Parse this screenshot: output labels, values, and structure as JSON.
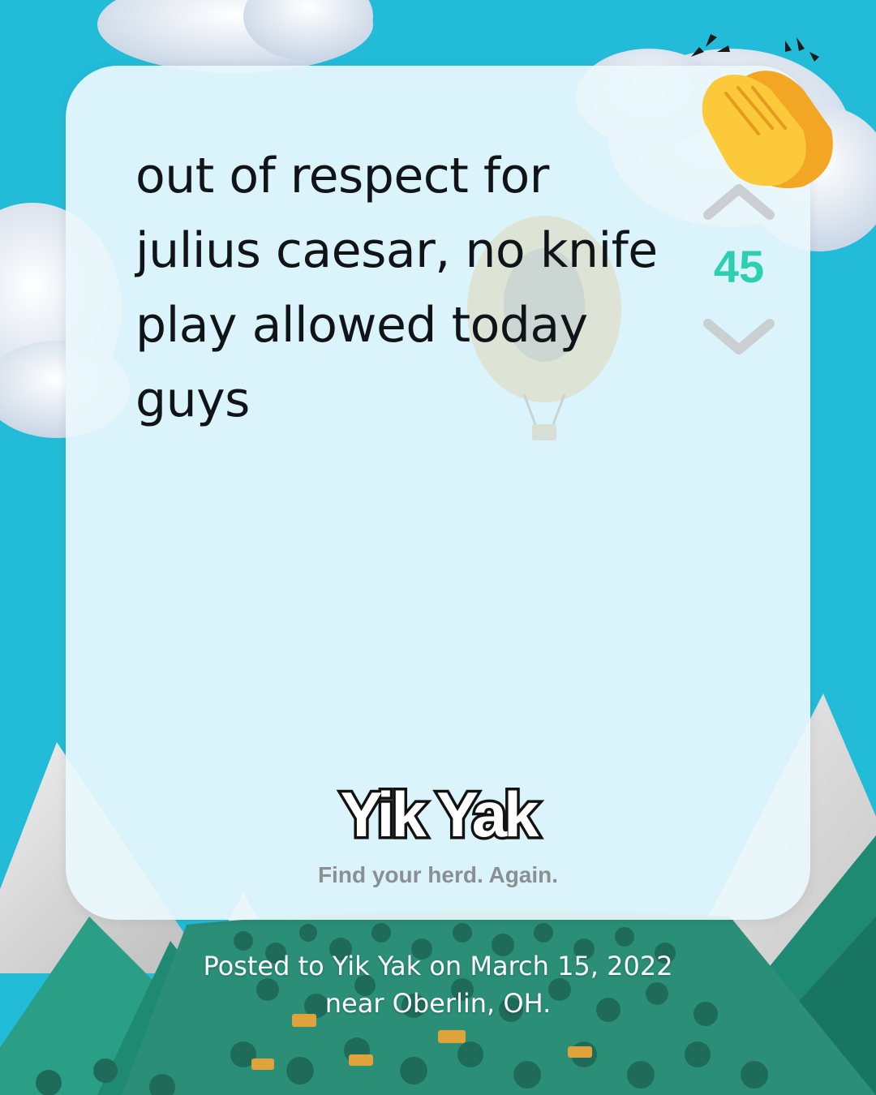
{
  "post": {
    "text": "out of respect for\njulius caesar, no knife\nplay allowed today\nguys"
  },
  "votes": {
    "count": "45",
    "upvote_icon": "chevron-up-icon",
    "downvote_icon": "chevron-down-icon"
  },
  "brand": {
    "logo_text": "Yik Yak",
    "tagline": "Find your herd. Again."
  },
  "caption": {
    "line1": "Posted to Yik Yak on March 15, 2022",
    "line2": "near Oberlin, OH."
  },
  "colors": {
    "sky": "#22bcd8",
    "vote_accent": "#2ecfb0",
    "text": "#101418",
    "tagline": "#8a8f94"
  }
}
